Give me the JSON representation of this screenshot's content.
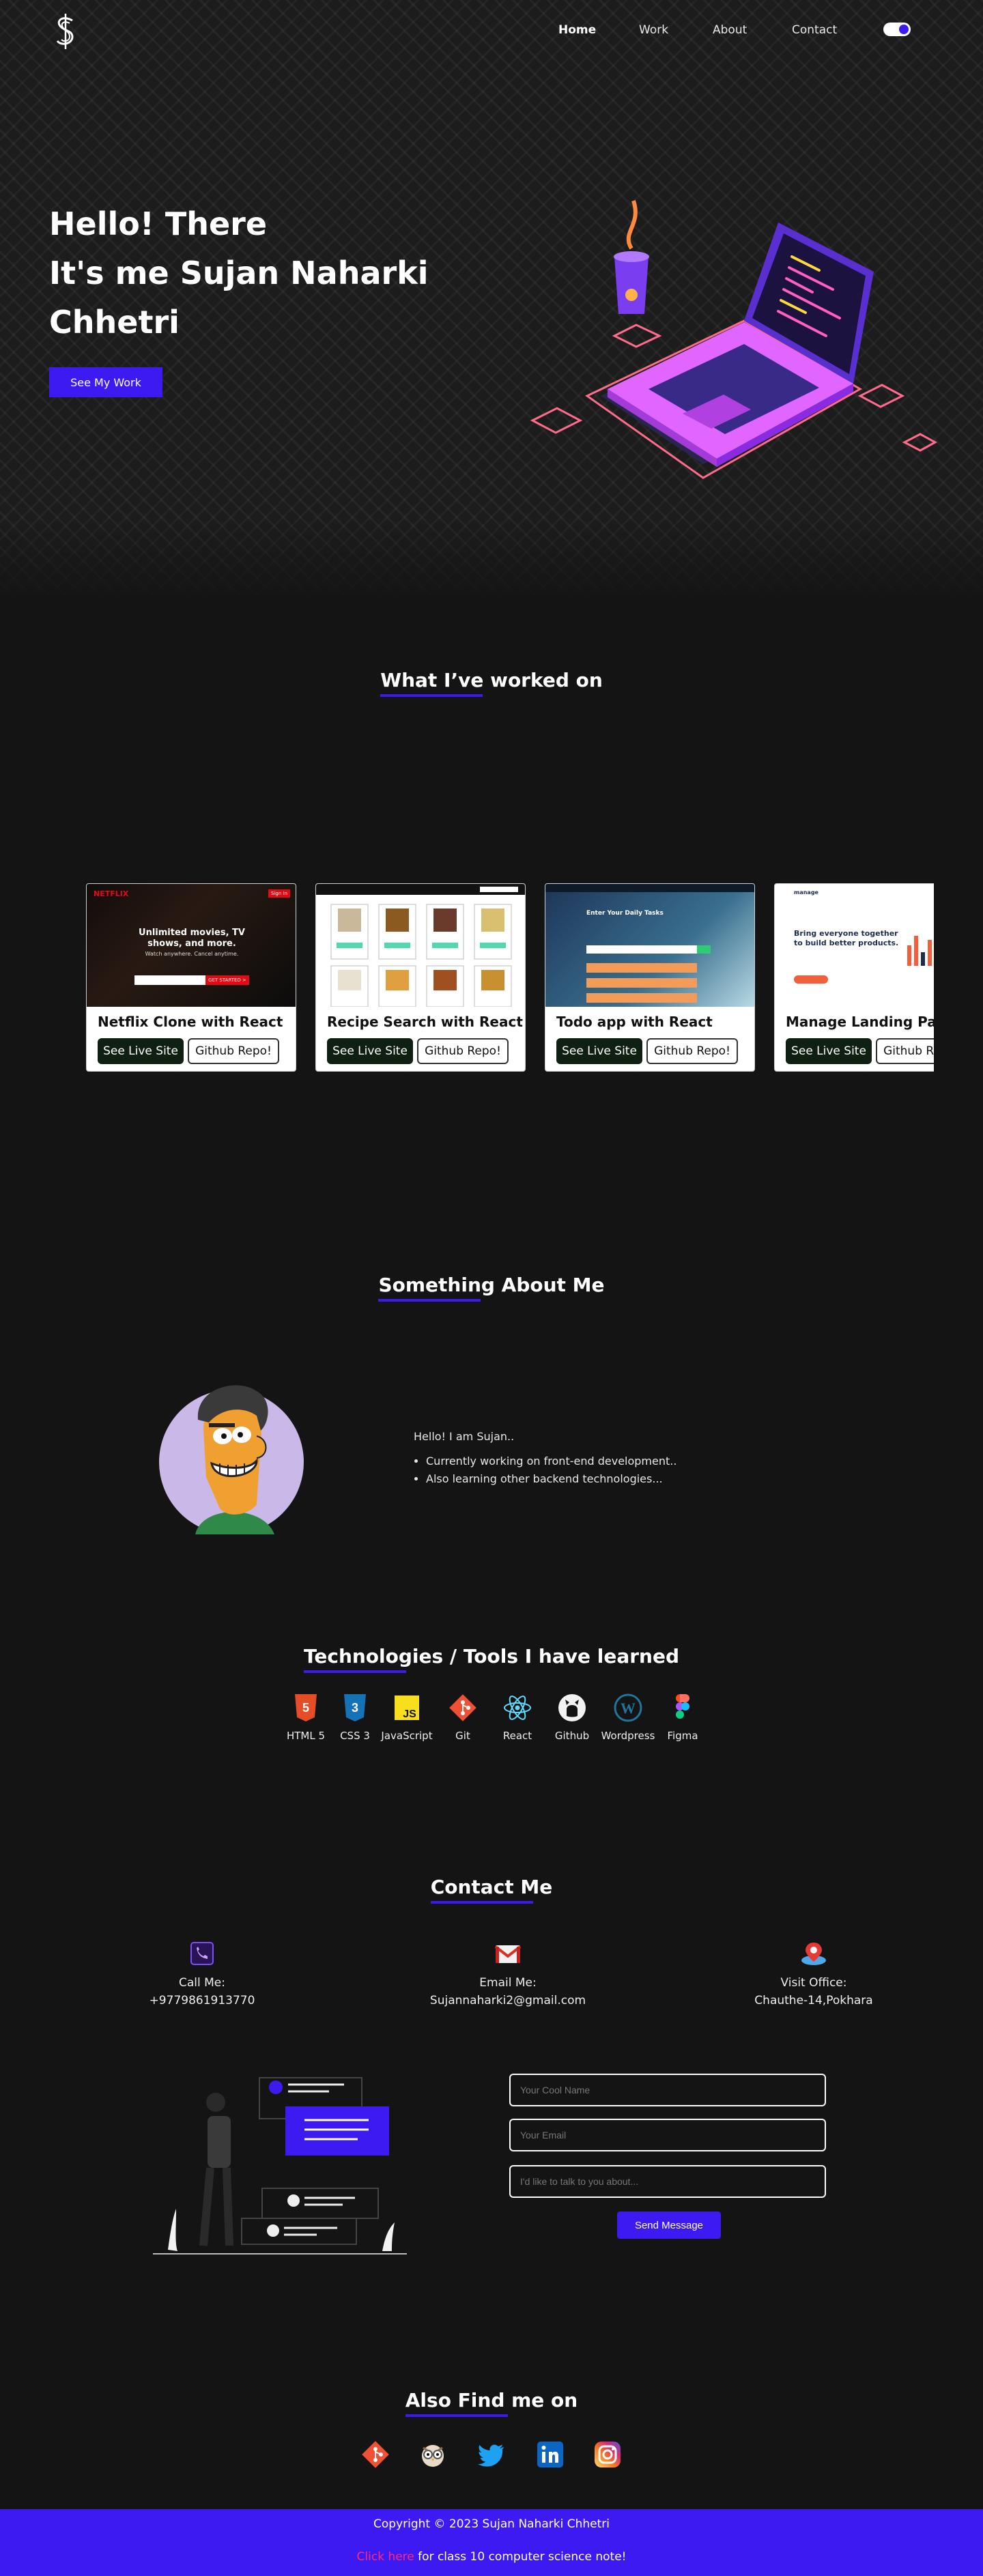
{
  "nav": {
    "items": [
      {
        "label": "Home",
        "active": true
      },
      {
        "label": "Work",
        "active": false
      },
      {
        "label": "About",
        "active": false
      },
      {
        "label": "Contact",
        "active": false
      }
    ]
  },
  "hero": {
    "line1": "Hello! There",
    "line2": "It's me Sujan Naharki",
    "line3": "Chhetri",
    "button": "See My Work"
  },
  "work": {
    "title": "What I’ve worked on",
    "cards": [
      {
        "title": "Netflix Clone with React",
        "live": "See Live Site",
        "repo": "Github Repo!",
        "shot": {
          "headline1": "Unlimited movies, TV",
          "headline2": "shows, and more.",
          "sub": "Watch anywhere. Cancel anytime.",
          "cta": "GET STARTED >",
          "brand": "NETFLIX",
          "signin": "Sign In"
        }
      },
      {
        "title": "Recipe Search with React",
        "live": "See Live Site",
        "repo": "Github Repo!"
      },
      {
        "title": "Todo app with React",
        "live": "See Live Site",
        "repo": "Github Repo!",
        "shot": {
          "heading": "Enter Your Daily Tasks"
        }
      },
      {
        "title": "Manage Landing Page",
        "live": "See Live Site",
        "repo": "Github Repo!",
        "shot": {
          "brand": "manage",
          "headline1": "Bring everyone together",
          "headline2": "to build better products."
        }
      }
    ]
  },
  "about": {
    "title": "Something About Me",
    "greeting": "Hello! I am Sujan..",
    "points": [
      "Currently working on front-end development..",
      "Also learning other backend technologies..."
    ]
  },
  "tech": {
    "title": "Technologies / Tools I have learned",
    "items": [
      {
        "label": "HTML 5",
        "icon": "html5-icon"
      },
      {
        "label": "CSS 3",
        "icon": "css3-icon"
      },
      {
        "label": "JavaScript",
        "icon": "javascript-icon"
      },
      {
        "label": "Git",
        "icon": "git-icon"
      },
      {
        "label": "React",
        "icon": "react-icon"
      },
      {
        "label": "Github",
        "icon": "github-icon"
      },
      {
        "label": "Wordpress",
        "icon": "wordpress-icon"
      },
      {
        "label": "Figma",
        "icon": "figma-icon"
      }
    ]
  },
  "contact": {
    "title": "Contact Me",
    "call_label": "Call Me:",
    "call_value": "+9779861913770",
    "email_label": "Email Me:",
    "email_value": "Sujannaharki2@gmail.com",
    "visit_label": "Visit Office:",
    "visit_value": "Chauthe-14,Pokhara",
    "name_placeholder": "Your Cool Name",
    "email_placeholder": "Your Email",
    "message_placeholder": "I'd like to talk to you about...",
    "send": "Send Message"
  },
  "social": {
    "title": "Also Find me on",
    "icons": [
      "git-icon",
      "owl-icon",
      "twitter-icon",
      "linkedin-icon",
      "instagram-icon"
    ]
  },
  "footer": {
    "copyright": "Copyright © 2023 Sujan Naharki Chhetri",
    "link": "Click here",
    "note": " for class 10 computer science note!"
  },
  "colors": {
    "accent": "#3d1af2",
    "background": "#141414",
    "link_pink": "#ff2a7a"
  }
}
